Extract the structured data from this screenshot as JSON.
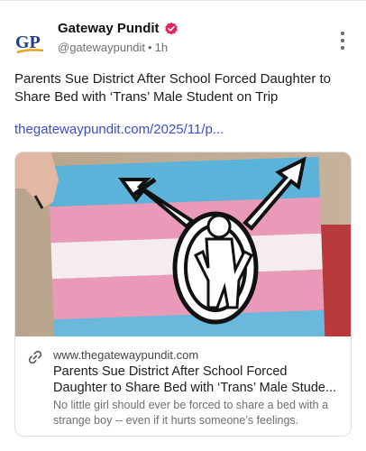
{
  "account": {
    "name": "Gateway Pundit",
    "handle": "@gatewaypundit",
    "time": "1h",
    "avatar_text": "GP"
  },
  "post": {
    "text": "Parents Sue District After School Forced Daughter to Share Bed with ‘Trans’ Male Student on Trip",
    "link": "thegatewaypundit.com/2025/11/p..."
  },
  "card": {
    "domain": "www.thegatewaypundit.com",
    "title_line1": "Parents Sue District After School Forced",
    "title_line2": "Daughter to Share Bed with ‘Trans’ Male Stude...",
    "description": "No little girl should ever be forced to share a bed with a strange boy -- even if it hurts someone’s feelings."
  },
  "colors": {
    "link": "#3b4fc4",
    "verified_badge": "#e0245e",
    "flag_blue": "#5bb3d9",
    "flag_pink": "#e89ab8",
    "avatar_blue": "#1d3f8a",
    "avatar_gold": "#e8a31b"
  },
  "icons": {
    "verified": "verified-badge-icon",
    "more": "more-vertical-icon",
    "link": "link-chain-icon"
  }
}
